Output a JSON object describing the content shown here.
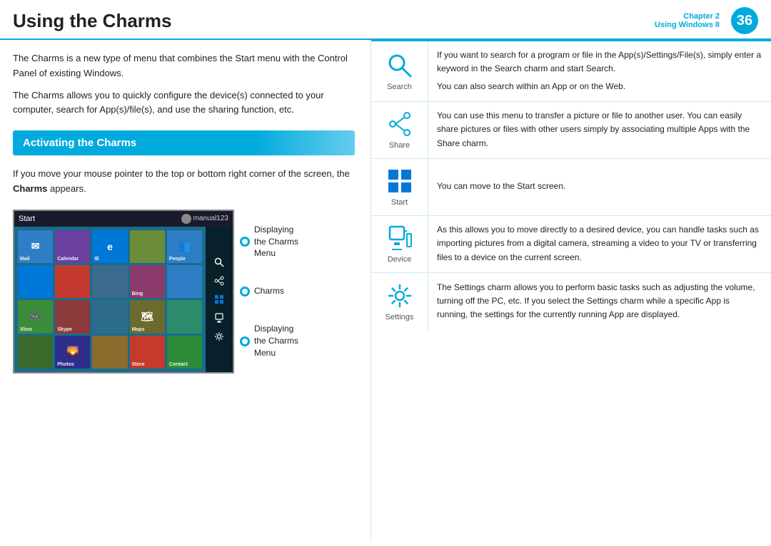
{
  "header": {
    "title": "Using the Charms",
    "chapter_label": "Chapter 2",
    "chapter_sub": "Using Windows 8",
    "chapter_num": "36"
  },
  "left": {
    "intro_p1": "The Charms is a new type of menu that combines the Start menu with the Control Panel of existing Windows.",
    "intro_p2": "The Charms allows you to quickly configure the device(s) connected to your computer, search for App(s)/file(s), and use the sharing function, etc.",
    "section_label": "Activating the Charms",
    "activating_text": "If you move your mouse pointer to the top or bottom right corner of the screen, the Charms appears.",
    "activating_bold": "Charms",
    "screenshot": {
      "taskbar_label": "Start",
      "taskbar_user": "manual123"
    },
    "callouts": [
      {
        "label": "Displaying\nthe Charms\nMenu"
      },
      {
        "label": "Charms"
      },
      {
        "label": "Displaying\nthe Charms\nMenu"
      }
    ]
  },
  "right": {
    "charms": [
      {
        "name": "Search",
        "icon": "search",
        "desc": "If you want to search for a program or file in the App(s)/Settings/File(s), simply enter a keyword in the Search charm and start Search.\n\nYou can also search within an App or on the Web."
      },
      {
        "name": "Share",
        "icon": "share",
        "desc": "You can use this menu to transfer a picture or file to another user. You can easily share pictures or files with other users simply by associating multiple Apps with the Share charm."
      },
      {
        "name": "Start",
        "icon": "start",
        "desc": "You can move to the Start screen."
      },
      {
        "name": "Device",
        "icon": "device",
        "desc": "As this allows you to move directly to a desired device, you can handle tasks such as importing pictures from a digital camera, streaming a video to your TV or transferring files to a device on the current screen."
      },
      {
        "name": "Settings",
        "icon": "settings",
        "desc": "The Settings charm allows you to perform basic tasks such as adjusting the volume, turning off the PC, etc. If you select the Settings charm while a specific App is running, the settings for the currently running App are displayed."
      }
    ]
  },
  "tiles": [
    {
      "color": "#2d7ec4",
      "label": "Mail"
    },
    {
      "color": "#6b3fa0",
      "label": "Calendar"
    },
    {
      "color": "#0078d7",
      "label": "IE",
      "big": true
    },
    {
      "color": "#6b8c3a",
      "label": ""
    },
    {
      "color": "#2d7ec4",
      "label": "People"
    },
    {
      "color": "#0078d7",
      "label": ""
    },
    {
      "color": "#c4392d",
      "label": ""
    },
    {
      "color": "#3a6b8c",
      "label": ""
    },
    {
      "color": "#8c3a6b",
      "label": "Bing"
    },
    {
      "color": "#2d7ec4",
      "label": ""
    },
    {
      "color": "#3a8c3a",
      "label": "Xbox"
    },
    {
      "color": "#8c3a3a",
      "label": "Skype"
    },
    {
      "color": "#2d6b8c",
      "label": ""
    },
    {
      "color": "#6b6b2d",
      "label": "Maps"
    },
    {
      "color": "#2d8c6b",
      "label": ""
    },
    {
      "color": "#3a6b2d",
      "label": ""
    },
    {
      "color": "#2d2d8c",
      "label": "Photos"
    },
    {
      "color": "#8c6b2d",
      "label": ""
    },
    {
      "color": "#c43a2d",
      "label": "Store"
    },
    {
      "color": "#2d8c3a",
      "label": "Contact"
    }
  ]
}
